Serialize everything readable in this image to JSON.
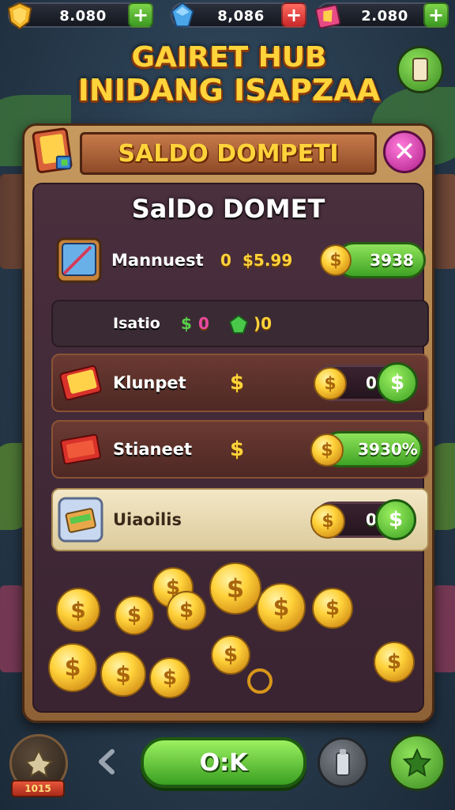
{
  "topbar": {
    "resources": [
      {
        "icon": "gold-shield-icon",
        "value": "8.080"
      },
      {
        "icon": "blue-gem-icon",
        "value": "8,086"
      },
      {
        "icon": "ticket-icon",
        "value": "2.080"
      }
    ]
  },
  "headline": {
    "line1": "GAIRET HUB",
    "line2": "INIDANG ISAPZAA"
  },
  "dialog": {
    "title": "SALDO DOMPETI",
    "subtitle": "SalDo DOMET",
    "close_symbol": "✕"
  },
  "rows": [
    {
      "label": "Mannuest",
      "amount_text": "0",
      "price_text": "$5.99",
      "pill_value": "3938"
    },
    {
      "label": "Isatio",
      "coin_count": "0",
      "gem_count": ")0"
    },
    {
      "label": "Klunpet",
      "pill_value": "0"
    },
    {
      "label": "Stianeet",
      "pill_value": "3930%"
    },
    {
      "label": "Uiaoilis",
      "pill_value": "0"
    }
  ],
  "currency_symbol": "$",
  "footer": {
    "ok_label": "O:K",
    "badge_label": "1015"
  },
  "colors": {
    "gold": "#ffd33a",
    "green": "#3fa324",
    "panel": "#c79a5f",
    "close": "#b01f8c"
  }
}
